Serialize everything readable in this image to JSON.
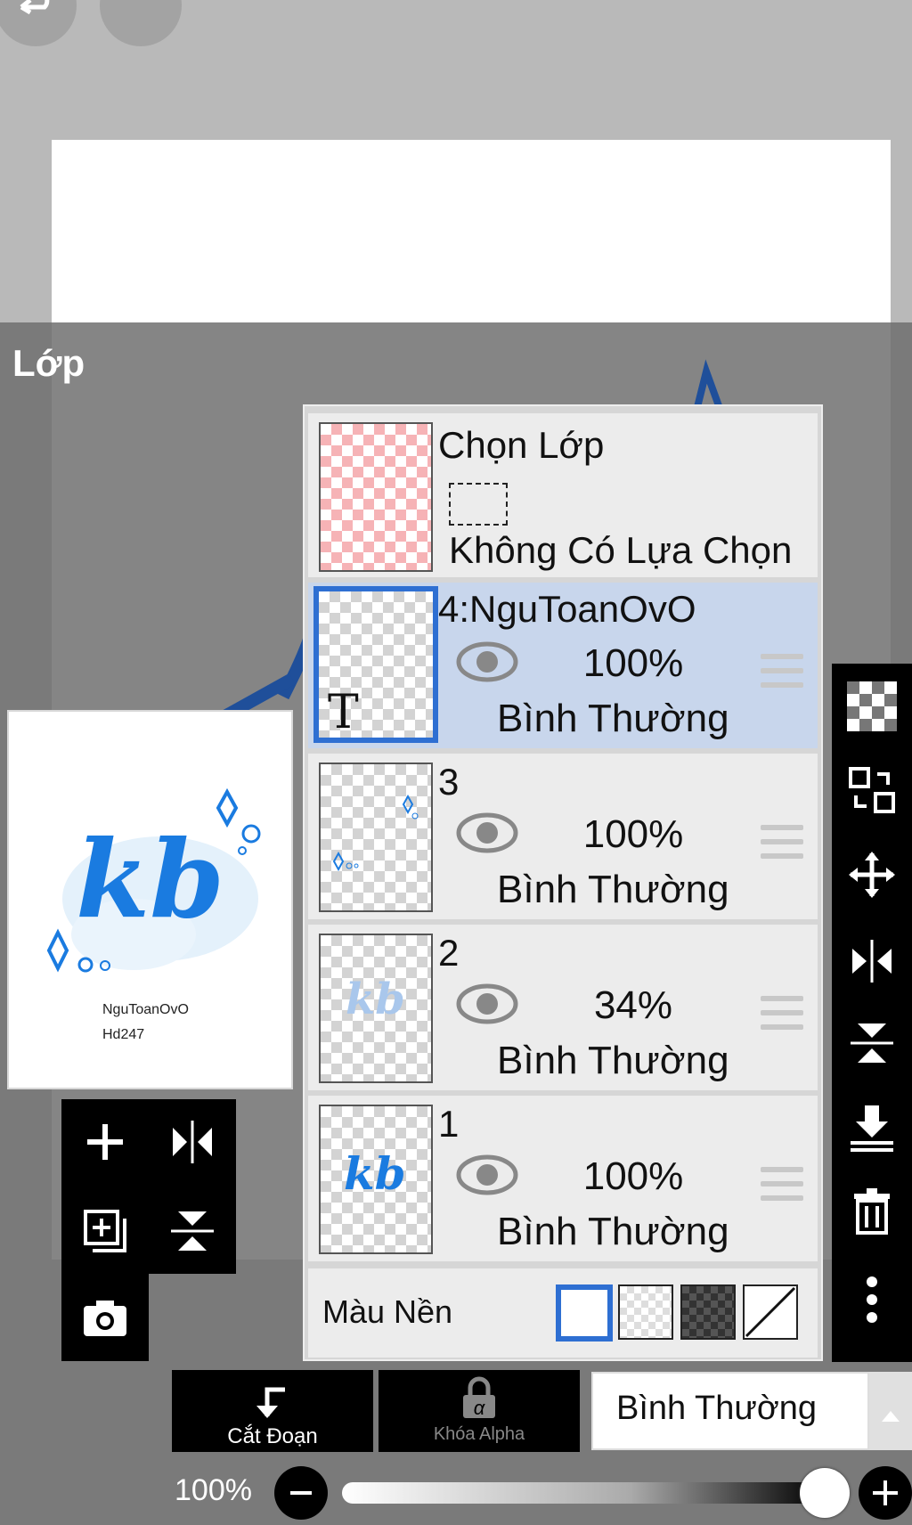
{
  "panel": {
    "title": "Lớp"
  },
  "preview": {
    "art_text": "kb",
    "line1": "NguToanOvO",
    "line2": "Hd247"
  },
  "selection_row": {
    "title": "Chọn Lớp",
    "status": "Không Có Lựa Chọn"
  },
  "layers": [
    {
      "name": "4:NguToanOvO",
      "opacity": "100%",
      "blend": "Bình Thường",
      "selected": true,
      "thumb_text": "T"
    },
    {
      "name": "3",
      "opacity": "100%",
      "blend": "Bình Thường",
      "selected": false
    },
    {
      "name": "2",
      "opacity": "34%",
      "blend": "Bình Thường",
      "selected": false
    },
    {
      "name": "1",
      "opacity": "100%",
      "blend": "Bình Thường",
      "selected": false
    }
  ],
  "background": {
    "label": "Màu Nền",
    "options": [
      "white",
      "transparent",
      "dark-checker",
      "none"
    ],
    "selected": "white"
  },
  "bottom_bar": {
    "clipping_label": "Cắt Đoạn",
    "alpha_lock_label": "Khóa Alpha",
    "blend_mode": "Bình Thường"
  },
  "opacity_slider": {
    "label": "100%",
    "value": 1.0
  },
  "colors": {
    "accent": "#2e6fd2",
    "art_blue": "#1a7be0",
    "checker_pink": "#f6b3b6"
  }
}
